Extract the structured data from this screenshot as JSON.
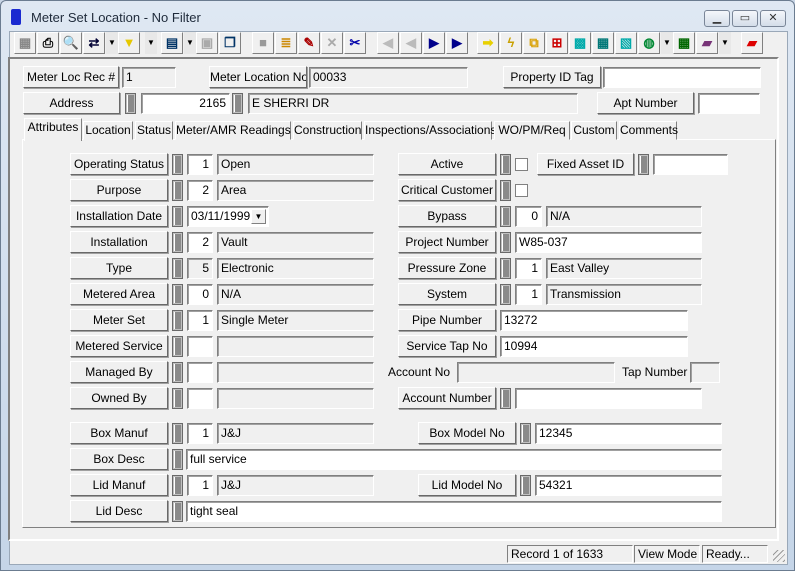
{
  "window": {
    "title": "Meter Set Location - No Filter",
    "icon": "meter-icon",
    "controls": [
      "minimize",
      "maximize",
      "close"
    ]
  },
  "toolbar": {
    "icons": [
      "grid-icon",
      "print-icon",
      "preview-icon",
      "query-icon",
      "filter-icon",
      "report-icon",
      "properties-icon",
      "copy-icon",
      "save-icon",
      "stack-icon",
      "edit-pencil-icon",
      "delete-icon",
      "cut-icon",
      "first-record-icon",
      "previous-record-icon",
      "next-record-icon",
      "last-record-icon",
      "goto-arrow-icon",
      "lightning-icon",
      "hierarchy-icon",
      "relationship-icon",
      "equipment-icon",
      "calendar-icon",
      "map-icon",
      "globe-search-icon",
      "spreadsheet-icon",
      "book-icon",
      "exit-icon"
    ]
  },
  "header": {
    "meter_loc_rec_label": "Meter Loc Rec #",
    "meter_loc_rec_value": "1",
    "meter_location_no_label": "Meter Location No",
    "meter_location_no_value": "00033",
    "property_id_tag_label": "Property ID Tag",
    "property_id_tag_value": "",
    "address_label": "Address",
    "address_number": "2165",
    "address_street": "E SHERRI DR",
    "apt_number_label": "Apt Number",
    "apt_number_value": ""
  },
  "tabs": [
    "Attributes",
    "Location",
    "Status",
    "Meter/AMR Readings",
    "Construction",
    "Inspections/Associations",
    "WO/PM/Req",
    "Custom",
    "Comments"
  ],
  "active_tab": "Attributes",
  "left_fields": [
    {
      "label": "Operating Status",
      "code": "1",
      "desc": "Open"
    },
    {
      "label": "Purpose",
      "code": "2",
      "desc": "Area"
    },
    {
      "label": "Installation Date",
      "date": "03/11/1999"
    },
    {
      "label": "Installation",
      "code": "2",
      "desc": "Vault"
    },
    {
      "label": "Type",
      "code": "5",
      "desc": "Electronic"
    },
    {
      "label": "Metered Area",
      "code": "0",
      "desc": "N/A"
    },
    {
      "label": "Meter Set",
      "code": "1",
      "desc": "Single Meter"
    },
    {
      "label": "Metered Service",
      "code": "",
      "desc": ""
    },
    {
      "label": "Managed By",
      "code": "",
      "desc": ""
    },
    {
      "label": "Owned By",
      "code": "",
      "desc": ""
    }
  ],
  "right_fields": {
    "active": {
      "label": "Active",
      "checked": false
    },
    "fixed_asset_id": {
      "label": "Fixed Asset ID",
      "value": ""
    },
    "critical_customer": {
      "label": "Critical Customer",
      "checked": false
    },
    "bypass": {
      "label": "Bypass",
      "code": "0",
      "desc": "N/A"
    },
    "project_number": {
      "label": "Project Number",
      "value": "W85-037"
    },
    "pressure_zone": {
      "label": "Pressure Zone",
      "code": "1",
      "desc": "East Valley"
    },
    "system": {
      "label": "System",
      "code": "1",
      "desc": "Transmission"
    },
    "pipe_number": {
      "label": "Pipe Number",
      "value": "13272"
    },
    "service_tap_no": {
      "label": "Service Tap No",
      "value": "10994"
    },
    "account_no": {
      "label": "Account No",
      "value": ""
    },
    "tap_number": {
      "label": "Tap Number",
      "value": ""
    },
    "account_number": {
      "label": "Account Number",
      "value": ""
    }
  },
  "box": {
    "manuf_label": "Box Manuf",
    "manuf_code": "1",
    "manuf_desc": "J&J",
    "model_label": "Box Model No",
    "model_value": "12345",
    "desc_label": "Box Desc",
    "desc_value": "full service"
  },
  "lid": {
    "manuf_label": "Lid Manuf",
    "manuf_code": "1",
    "manuf_desc": "J&J",
    "model_label": "Lid Model No",
    "model_value": "54321",
    "desc_label": "Lid Desc",
    "desc_value": "tight seal"
  },
  "status_bar": {
    "record": "Record 1 of 1633",
    "mode": "View Mode",
    "state": "Ready..."
  }
}
